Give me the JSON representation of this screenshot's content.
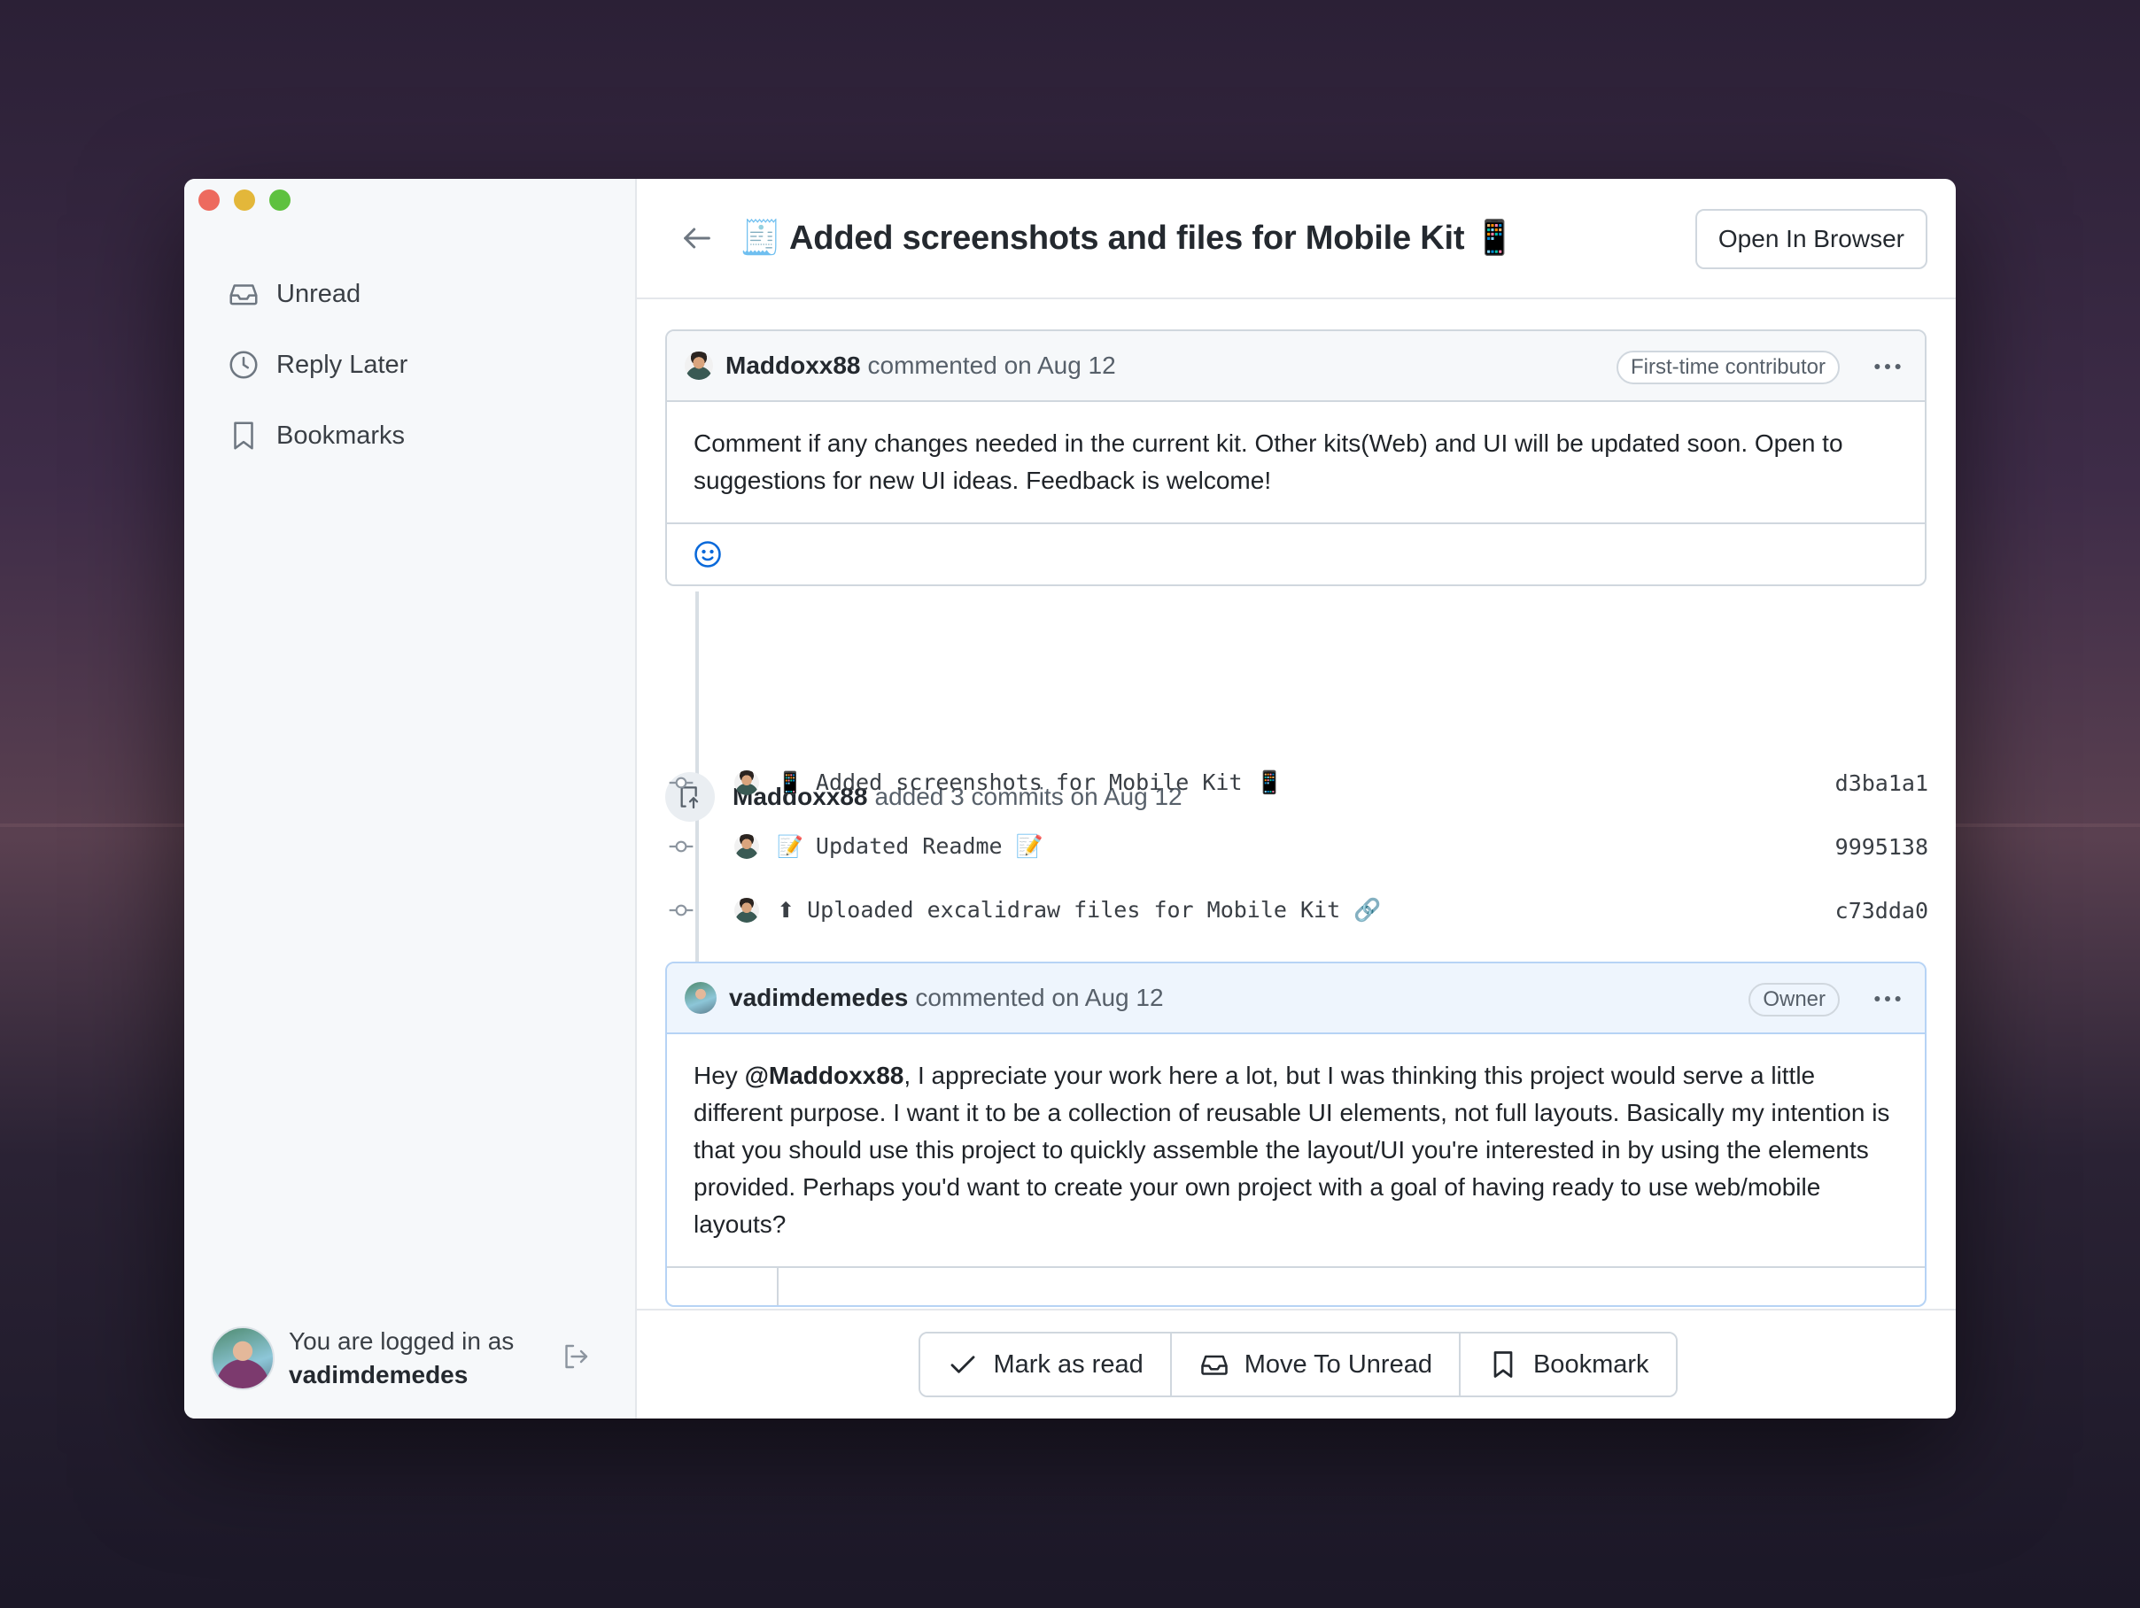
{
  "sidebar": {
    "items": [
      {
        "label": "Unread",
        "icon": "inbox-icon"
      },
      {
        "label": "Reply Later",
        "icon": "clock-icon"
      },
      {
        "label": "Bookmarks",
        "icon": "bookmark-icon"
      }
    ],
    "user": {
      "prefix": "You are logged in as",
      "username": "vadimdemedes"
    }
  },
  "header": {
    "title": "🧾 Added screenshots and files for Mobile Kit 📱",
    "open_button": "Open In Browser"
  },
  "comment1": {
    "author": "Maddoxx88",
    "meta": "commented on Aug 12",
    "badge": "First-time contributor",
    "body": "Comment if any changes needed in the current kit. Other kits(Web) and UI will be updated soon. Open to suggestions for new UI ideas. Feedback is welcome!"
  },
  "event": {
    "author": "Maddoxx88",
    "text": "added 3 commits on Aug 12"
  },
  "commits": [
    {
      "emoji": "📱",
      "message": "Added screenshots for Mobile Kit 📱",
      "sha": "d3ba1a1"
    },
    {
      "emoji": "📝",
      "message": "Updated Readme 📝",
      "sha": "9995138"
    },
    {
      "emoji": "⬆",
      "message": "Uploaded excalidraw files for Mobile Kit 🔗",
      "sha": "c73dda0"
    }
  ],
  "comment2": {
    "author": "vadimdemedes",
    "meta": "commented on Aug 12",
    "badge": "Owner",
    "body_prefix": "Hey ",
    "mention": "@Maddoxx88",
    "body_rest": ", I appreciate your work here a lot, but I was thinking this project would serve a little different purpose. I want it to be a collection of reusable UI elements, not full layouts. Basically my intention is that you should use this project to quickly assemble the layout/UI you're interested in by using the elements provided. Perhaps you'd want to create your own project with a goal of having ready to use web/mobile layouts?"
  },
  "footer": {
    "mark_read": "Mark as read",
    "move_unread": "Move To Unread",
    "bookmark": "Bookmark"
  },
  "colors": {
    "link_blue": "#0969da",
    "owner_header_bg": "#eef5fd"
  }
}
